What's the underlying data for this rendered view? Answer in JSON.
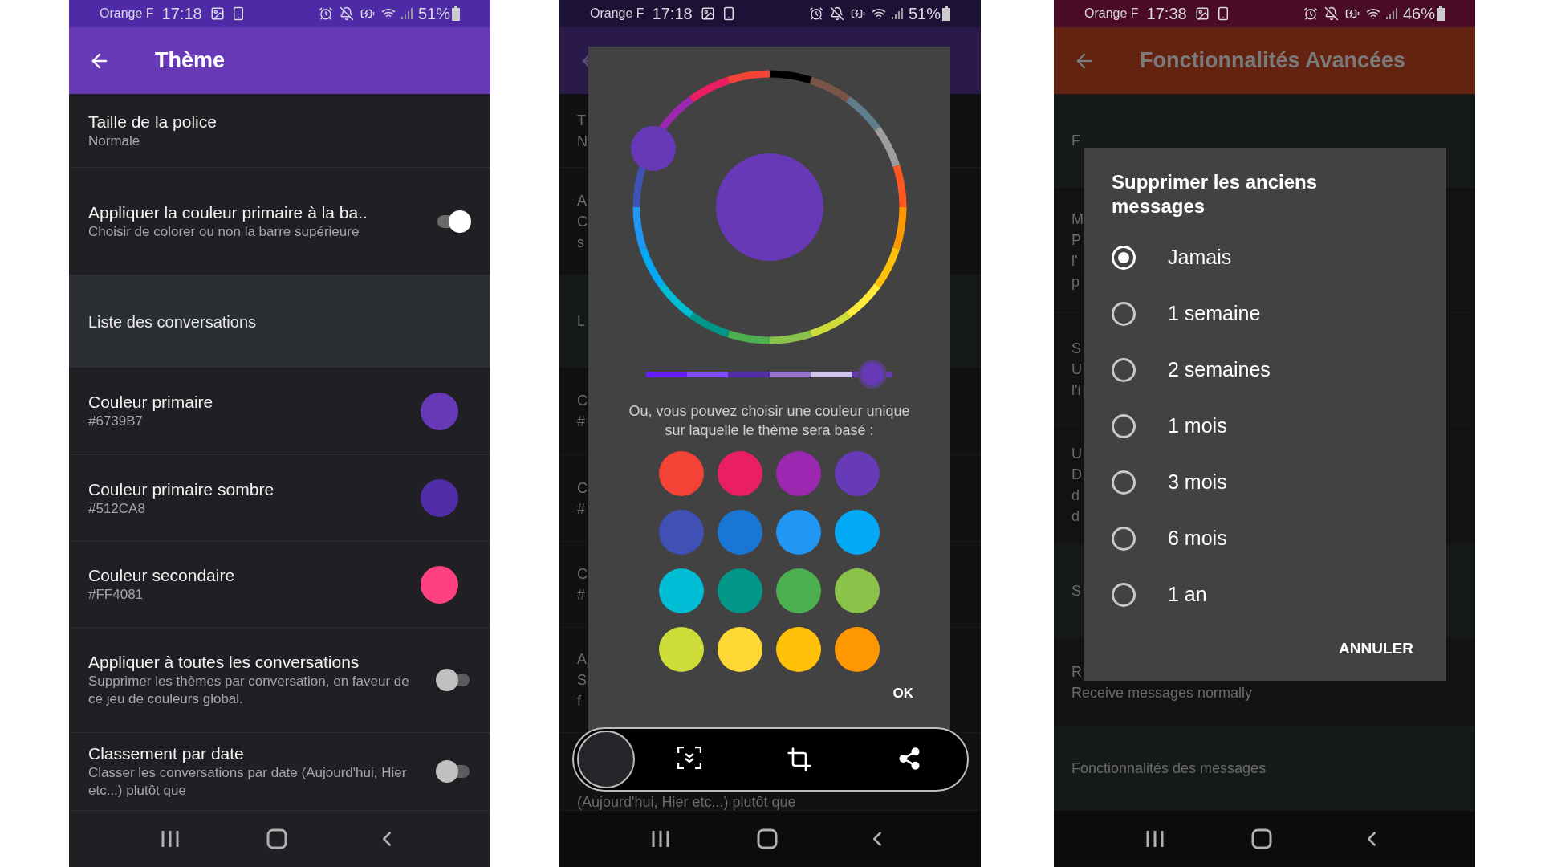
{
  "phones": [
    {
      "kind": "settings",
      "status": {
        "carrier": "Orange F",
        "time": "17:18",
        "battery": "51%"
      },
      "title": "Thème",
      "items": [
        {
          "kind": "value",
          "title": "Taille de la police",
          "subtitle": "Normale"
        },
        {
          "kind": "switch",
          "title": "Appliquer la couleur primaire à la ba..",
          "subtitle": "Choisir de colorer ou non la barre supérieure",
          "on": true
        },
        {
          "kind": "header",
          "title": "Liste des conversations"
        },
        {
          "kind": "color",
          "title": "Couleur primaire",
          "subtitle": "#6739B7",
          "color": "#6739b7"
        },
        {
          "kind": "color",
          "title": "Couleur primaire sombre",
          "subtitle": "#512CA8",
          "color": "#512ca8"
        },
        {
          "kind": "color",
          "title": "Couleur secondaire",
          "subtitle": "#FF4081",
          "color": "#ff4081"
        },
        {
          "kind": "switch",
          "title": "Appliquer à toutes les conversations",
          "subtitle": "Supprimer les thèmes par conversation, en faveur de ce jeu de couleurs global.",
          "on": false
        },
        {
          "kind": "switch",
          "title": "Classement par date",
          "subtitle": "Classer les conversations par date (Aujourd'hui, Hier etc...) plutôt que",
          "on": false
        }
      ]
    },
    {
      "kind": "picker",
      "status": {
        "carrier": "Orange F",
        "time": "17:18",
        "battery": "51%"
      },
      "background_rows": [
        {
          "kind": "row",
          "lines": [
            "T",
            "N"
          ]
        },
        {
          "kind": "row",
          "lines": [
            "A",
            "C",
            "s"
          ]
        },
        {
          "kind": "header",
          "lines": [
            "L"
          ]
        },
        {
          "kind": "row",
          "lines": [
            "C",
            "#"
          ]
        },
        {
          "kind": "row",
          "lines": [
            "C",
            "#"
          ]
        },
        {
          "kind": "row",
          "lines": [
            "C",
            "#"
          ]
        },
        {
          "kind": "row",
          "lines": [
            "A",
            "S",
            "f"
          ]
        },
        {
          "kind": "bottom",
          "lines": [
            "(Aujourd'hui, Hier etc...) plutôt que"
          ]
        }
      ],
      "dialog": {
        "color": "#6739b7",
        "shade": {
          "level": 0.92
        },
        "hint": "Ou, vous pouvez choisir une couleur unique sur laquelle le thème sera basé :",
        "swatches": [
          {
            "color": "#f44336"
          },
          {
            "color": "#e91e63"
          },
          {
            "color": "#9c27b0"
          },
          {
            "color": "#673ab7"
          },
          {
            "color": "#3f51b5"
          },
          {
            "color": "#1976d2"
          },
          {
            "color": "#2196f3"
          },
          {
            "color": "#03a9f4"
          },
          {
            "color": "#00bcd4"
          },
          {
            "color": "#009688"
          },
          {
            "color": "#4caf50"
          },
          {
            "color": "#8bc34a"
          },
          {
            "color": "#cddc39"
          },
          {
            "color": "#fdd835"
          },
          {
            "color": "#ffc107"
          },
          {
            "color": "#ff9800"
          }
        ],
        "ok": "OK"
      }
    },
    {
      "kind": "choice",
      "status": {
        "carrier": "Orange F",
        "time": "17:38",
        "battery": "46%"
      },
      "title": "Fonctionnalités Avancées",
      "background_rows": [
        {
          "kind": "header",
          "lines": [
            "F"
          ]
        },
        {
          "kind": "row",
          "lines": [
            "M",
            "P",
            "l'",
            "p"
          ]
        },
        {
          "kind": "row",
          "lines": [
            "S",
            "U",
            "l'i"
          ]
        },
        {
          "kind": "row",
          "lines": [
            "U",
            "D",
            "d",
            "d"
          ]
        },
        {
          "kind": "header",
          "lines": [
            "S"
          ]
        },
        {
          "kind": "row",
          "lines": [
            "R",
            "Receive messages normally"
          ]
        },
        {
          "kind": "header",
          "lines": [
            "Fonctionnalités des messages"
          ]
        }
      ],
      "dialog": {
        "title": "Supprimer les anciens messages",
        "options": [
          {
            "label": "Jamais",
            "selected": true
          },
          {
            "label": "1 semaine",
            "selected": false
          },
          {
            "label": "2 semaines",
            "selected": false
          },
          {
            "label": "1 mois",
            "selected": false
          },
          {
            "label": "3 mois",
            "selected": false
          },
          {
            "label": "6 mois",
            "selected": false
          },
          {
            "label": "1 an",
            "selected": false
          }
        ],
        "cancel": "ANNULER"
      }
    }
  ]
}
